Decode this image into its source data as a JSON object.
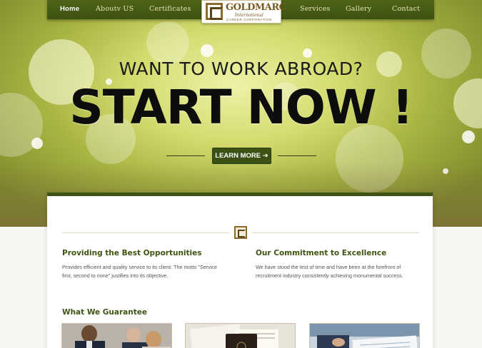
{
  "nav": {
    "left": [
      "Home",
      "Aboutv US",
      "Certificates"
    ],
    "right": [
      "Services",
      "Gallery",
      "Contact"
    ]
  },
  "logo": {
    "name": "GOLDMARC",
    "line1": "International",
    "line2": "CAREER CORPORATION"
  },
  "hero": {
    "heading": "WANT TO WORK ABROAD?",
    "headline": "START NOW !",
    "button": "LEARN MORE ➔"
  },
  "columns": [
    {
      "title": "Providing the Best Opportunities",
      "text": "Provides efficient and quality service to its client. The motto \"Service first, second to none\" justifies into its objective."
    },
    {
      "title": "Our Commitment to Excellence",
      "text": "We have stood the test of time and have been at the forefront of recruitment industry consistently achieving monumental success."
    }
  ],
  "guarantee": {
    "title": "What We Guarantee",
    "images": [
      "business-meeting-photo",
      "passport-documents-photo",
      "paperwork-signing-photo"
    ]
  },
  "colors": {
    "nav_bg": "#3c5210",
    "accent_green": "#3d5412",
    "logo_gold": "#7a5a22"
  }
}
